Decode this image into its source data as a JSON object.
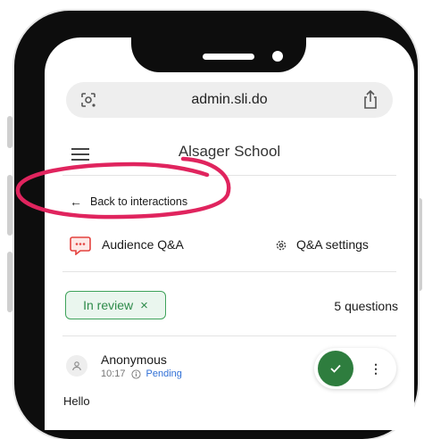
{
  "browser": {
    "url": "admin.sli.do",
    "icons": {
      "lens": "lens-icon",
      "share": "share-icon"
    }
  },
  "header": {
    "title": "Alsager School",
    "menu_icon": "menu-icon"
  },
  "nav": {
    "back_label": "Back to interactions",
    "back_arrow": "←"
  },
  "interaction": {
    "title": "Audience Q&A",
    "settings_label": "Q&A settings"
  },
  "filter": {
    "chip_label": "In review",
    "chip_close": "×",
    "count_label": "5 questions"
  },
  "question": {
    "author": "Anonymous",
    "time": "10:17",
    "status": "Pending",
    "text": "Hello",
    "more": "⋮"
  },
  "colors": {
    "accent_green": "#2e7d3e",
    "chip_green": "#3fa35b",
    "highlight_pink": "#e0245e",
    "pending_blue": "#2f6fd6",
    "qa_red": "#e4423f"
  }
}
